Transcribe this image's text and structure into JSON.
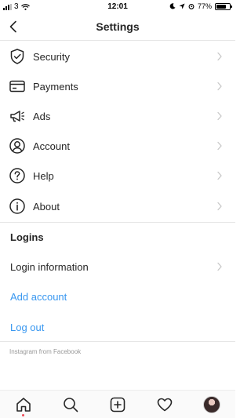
{
  "status_bar": {
    "carrier": "3",
    "time": "12:01",
    "battery": "77%",
    "battery_level": 0.77
  },
  "header": {
    "title": "Settings",
    "back_icon": "chevron-left-icon"
  },
  "menu": [
    {
      "label": "Security",
      "icon": "shield-check-icon"
    },
    {
      "label": "Payments",
      "icon": "credit-card-icon"
    },
    {
      "label": "Ads",
      "icon": "megaphone-icon"
    },
    {
      "label": "Account",
      "icon": "user-circle-icon"
    },
    {
      "label": "Help",
      "icon": "question-circle-icon"
    },
    {
      "label": "About",
      "icon": "info-circle-icon"
    }
  ],
  "logins": {
    "title": "Logins",
    "login_information": "Login information",
    "add_account": "Add account",
    "log_out": "Log out"
  },
  "footer": {
    "text": "Instagram from Facebook"
  },
  "tab_bar": {
    "tabs": [
      "home-icon",
      "search-icon",
      "add-post-icon",
      "heart-icon",
      "profile-avatar"
    ],
    "active": "home-icon"
  },
  "colors": {
    "link": "#3897f0",
    "text": "#262626",
    "muted": "#999999",
    "divider": "#e6e6e6",
    "notification_dot": "#ed4956"
  }
}
